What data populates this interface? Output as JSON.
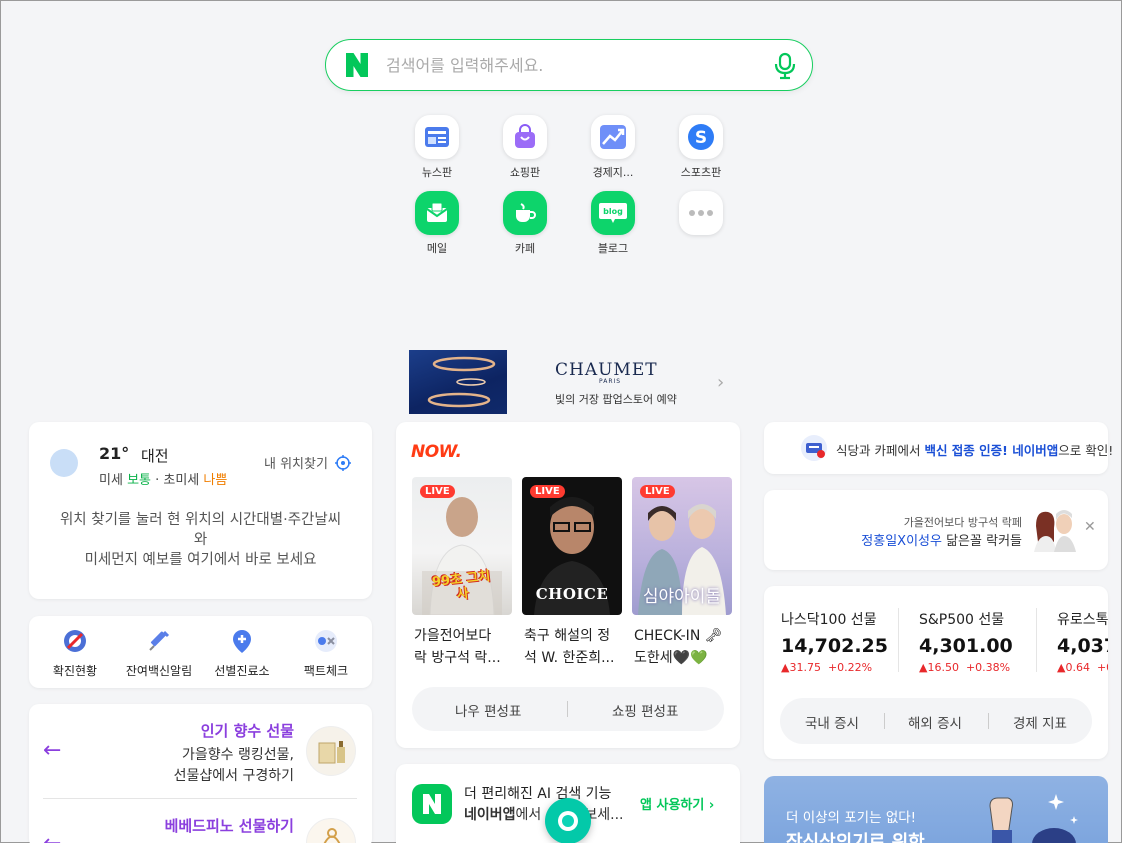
{
  "search": {
    "placeholder": "검색어를 입력해주세요."
  },
  "apps": [
    {
      "label": "뉴스판",
      "icon": "news-icon"
    },
    {
      "label": "쇼핑판",
      "icon": "shopping-bag-icon"
    },
    {
      "label": "경제지...",
      "icon": "stock-chart-icon"
    },
    {
      "label": "스포츠판",
      "icon": "sports-icon"
    },
    {
      "label": "메일",
      "icon": "mail-icon"
    },
    {
      "label": "카페",
      "icon": "cafe-icon"
    },
    {
      "label": "블로그",
      "icon": "blog-icon"
    },
    {
      "label": "",
      "icon": "more-icon"
    }
  ],
  "blog_icon_text": "blog",
  "banner": {
    "brand": "CHAUMET",
    "brand_sub": "PARIS",
    "text": "빛의 거장 팝업스토어 예약"
  },
  "weather": {
    "temp": "21°",
    "city": "대전",
    "dust_label": "미세",
    "dust_value": "보통",
    "sep": " · ",
    "ultra_label": "초미세",
    "ultra_value": "나쁨",
    "locate": "내 위치찾기",
    "desc_line1": "위치 찾기를 눌러 현 위치의 시간대별·주간날씨",
    "desc_line2": "와",
    "desc_line3": "미세먼지 예보를 여기에서 바로 보세요"
  },
  "quick": [
    {
      "label": "확진현황",
      "icon": "virus-icon"
    },
    {
      "label": "잔여백신알림",
      "icon": "syringe-icon"
    },
    {
      "label": "선별진료소",
      "icon": "location-pin-icon"
    },
    {
      "label": "팩트체크",
      "icon": "fact-check-icon"
    }
  ],
  "gift": [
    {
      "title": "인기 향수 선물",
      "line1": "가을향수 랭킹선물,",
      "line2": "선물샵에서 구경하기"
    },
    {
      "title": "베베드피노 선물하기",
      "line1": "",
      "line2": ""
    }
  ],
  "now": {
    "logo": "NOW.",
    "live_label": "LIVE",
    "thumb_texts": [
      "99초 그치사",
      "CHOICE",
      "심야아이돌"
    ],
    "items": [
      {
        "title_line1": "가을전어보다",
        "title_line2": "락 방구석 락..."
      },
      {
        "title_line1": "축구 해설의 정",
        "title_line2": "석 W. 한준희..."
      },
      {
        "title_line1": "CHECK-IN 🗝",
        "title_line2": "도한세🖤💚"
      }
    ],
    "tabs": [
      "나우 편성표",
      "쇼핑 편성표"
    ]
  },
  "promo": {
    "line1": "더 편리해진 AI 검색 기능",
    "line2_bold": "네이버앱",
    "line2_rest": "에서 사용해보세...",
    "cta": "앱 사용하기 ›"
  },
  "vaccine": {
    "pre": "식당과 카페에서 ",
    "highlight": "백신 접종 인증! 네이버앱",
    "post": "으로 확인!"
  },
  "ad": {
    "line1": "가을전어보다 방구석 락페",
    "highlight": "정홍일X이성우",
    "rest": " 닮은꼴 락커들"
  },
  "stocks": [
    {
      "name": "나스닥100 선물",
      "value": "14,702.25",
      "change": "▲31.75",
      "percent": "+0.22%"
    },
    {
      "name": "S&P500 선물",
      "value": "4,301.00",
      "change": "▲16.50",
      "percent": "+0.38%"
    },
    {
      "name": "유로스톡",
      "value": "4,037.",
      "change": "▲0.64",
      "percent": "+0"
    }
  ],
  "stock_tabs": [
    "국내 증시",
    "해외 증시",
    "경제 지표"
  ],
  "recruit": {
    "line1": "더 이상의 포기는 없다!",
    "line2": "장신상의기로 위한"
  },
  "colors": {
    "naver_green": "#03c75a",
    "accent_purple": "#8b3fde",
    "blue_link": "#1a4fd6",
    "down_red": "#e8282b"
  }
}
